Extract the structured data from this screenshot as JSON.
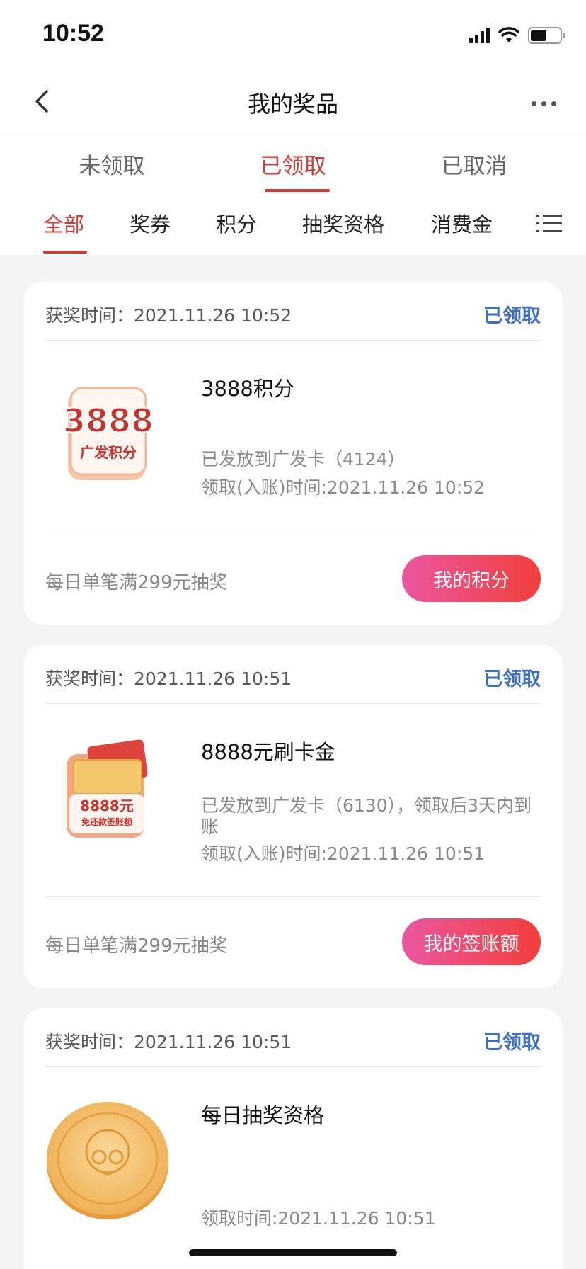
{
  "status_bar": {
    "time": "10:52"
  },
  "nav": {
    "title": "我的奖品"
  },
  "status_tabs": [
    {
      "label": "未领取"
    },
    {
      "label": "已领取"
    },
    {
      "label": "已取消"
    }
  ],
  "category_tabs": [
    {
      "label": "全部"
    },
    {
      "label": "奖券"
    },
    {
      "label": "积分"
    },
    {
      "label": "抽奖资格"
    },
    {
      "label": "消费金"
    }
  ],
  "cards": [
    {
      "award_time": "获奖时间：2021.11.26 10:52",
      "state": "已领取",
      "title": "3888积分",
      "image_text_big": "3888",
      "image_text_small": "广发积分",
      "desc1": "已发放到广发卡（4124）",
      "desc2": "领取(入账)时间:2021.11.26 10:52",
      "condition": "每日单笔满299元抽奖",
      "button": "我的积分"
    },
    {
      "award_time": "获奖时间：2021.11.26 10:51",
      "state": "已领取",
      "title": "8888元刷卡金",
      "image_text_big": "8888元",
      "image_text_small": "免还款签账额",
      "desc1": "已发放到广发卡（6130），领取后3天内到账",
      "desc2": "领取(入账)时间:2021.11.26 10:51",
      "condition": "每日单笔满299元抽奖",
      "button": "我的签账额"
    },
    {
      "award_time": "获奖时间：2021.11.26 10:51",
      "state": "已领取",
      "title": "每日抽奖资格",
      "desc2": "领取时间:2021.11.26 10:51"
    }
  ],
  "colors": {
    "accent": "#d23a34",
    "state_blue": "#3c6fc5",
    "button_start": "#ea56a0",
    "button_end": "#f23f3b"
  }
}
